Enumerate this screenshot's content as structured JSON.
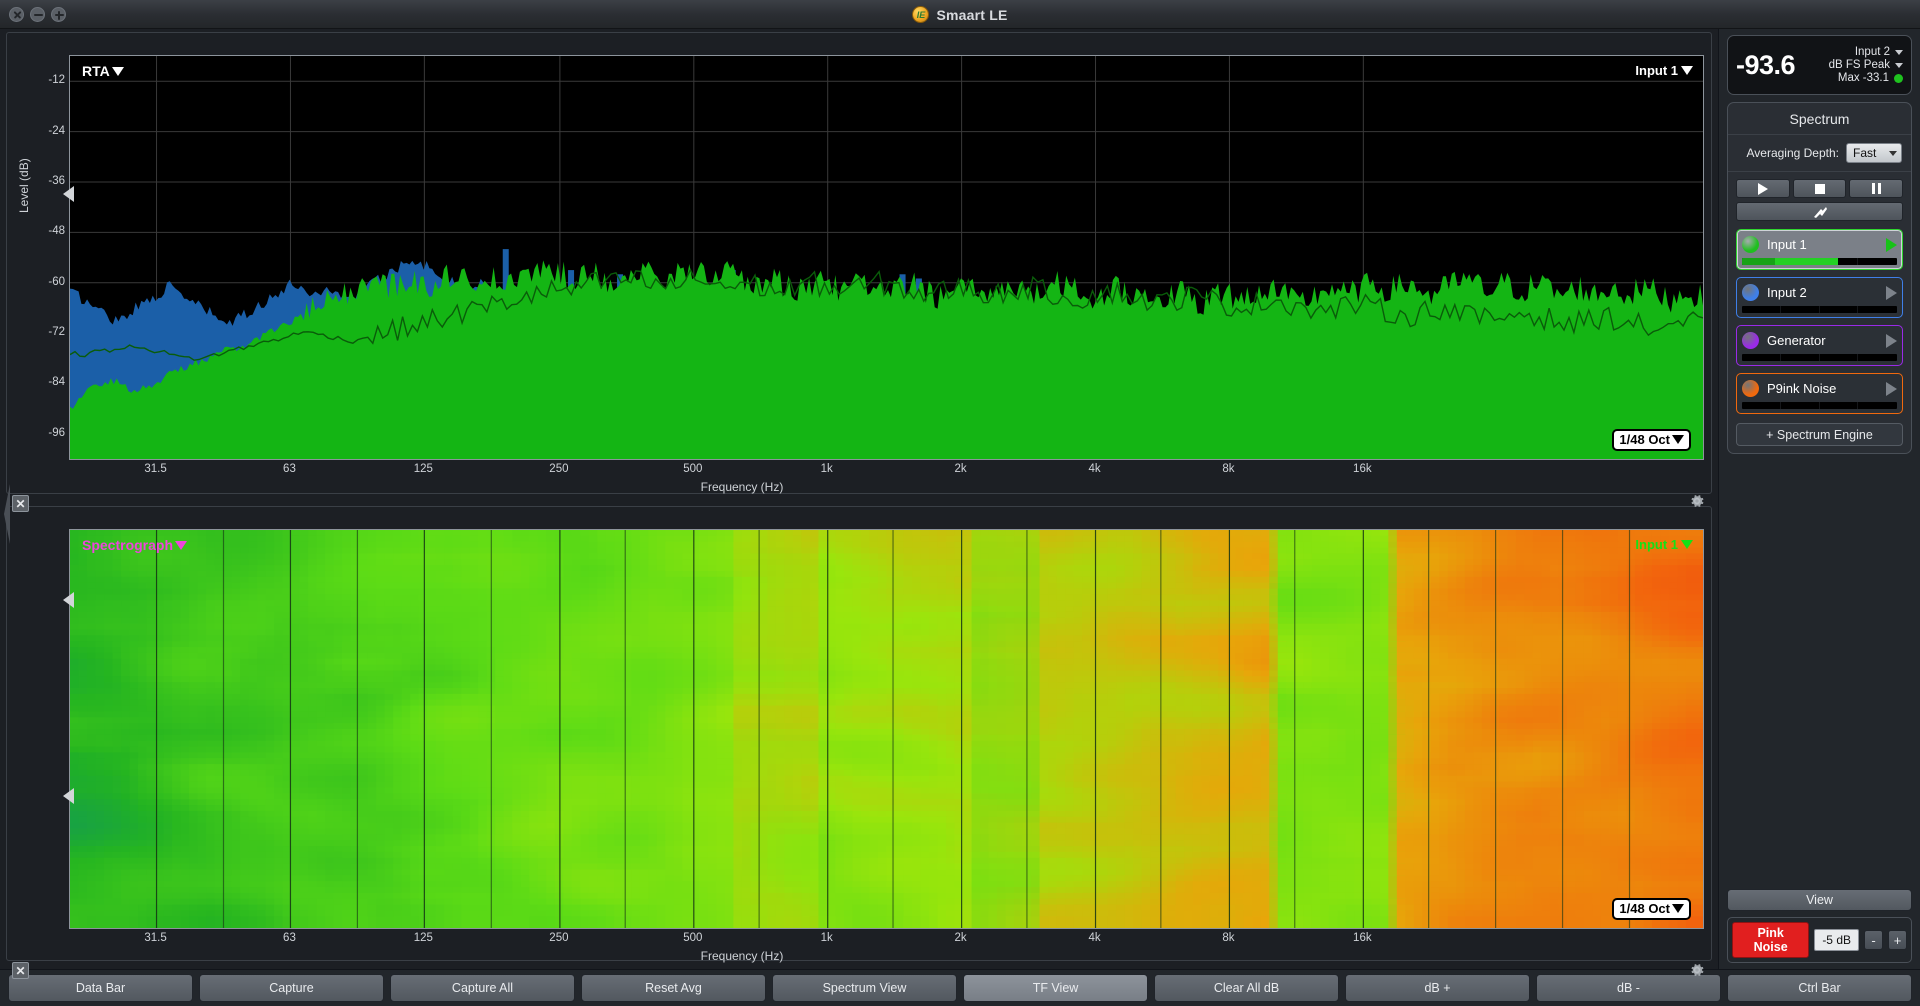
{
  "window": {
    "title": "Smaart LE",
    "logo_icon": "smaart-logo-icon",
    "buttons": {
      "close": "close-icon",
      "minimize": "minimize-icon",
      "maximize": "maximize-icon"
    }
  },
  "rta": {
    "title": "RTA",
    "corner_label": "Input 1",
    "octave_badge": "1/48 Oct",
    "ylabel": "Level (dB)",
    "xlabel": "Frequency (Hz)"
  },
  "spectrograph": {
    "title": "Spectrograph",
    "corner_label": "Input 1",
    "octave_badge": "1/48 Oct",
    "xlabel": "Frequency (Hz)",
    "title_color": "#ee44dd"
  },
  "data_bar": {
    "value": "-93.6",
    "source": "Input 2",
    "unit": "dB FS Peak",
    "max_label": "Max -33.1",
    "status_color": "#1fc21f"
  },
  "spectrum_panel": {
    "heading": "Spectrum",
    "averaging_label": "Averaging Depth:",
    "averaging_value": "Fast",
    "transport": [
      {
        "name": "play-button",
        "icon": "play-icon"
      },
      {
        "name": "stop-button",
        "icon": "stop-icon"
      },
      {
        "name": "pause-button",
        "icon": "pause-icon"
      }
    ],
    "tools_icon": "tools-hammer-wrench-icon",
    "engines": [
      {
        "label": "Input 1",
        "color": "#1fbf1f",
        "border": "#2fd62f",
        "active": true,
        "meter": 62
      },
      {
        "label": "Input 2",
        "color": "#3f7fe8",
        "border": "#3f7fe8",
        "active": false,
        "meter": 0
      },
      {
        "label": "Generator",
        "color": "#9a2ae8",
        "border": "#9a2ae8",
        "active": false,
        "meter": 0
      },
      {
        "label": "P9ink Noise",
        "color": "#f0690e",
        "border": "#f0690e",
        "active": false,
        "meter": 0
      }
    ],
    "add_engine": "+ Spectrum Engine"
  },
  "panel_bottom": {
    "view_label": "View",
    "generator_button": "Pink Noise",
    "generator_level": "-5 dB",
    "minus": "-",
    "plus": "+"
  },
  "ctrl_bar": [
    {
      "label": "Data Bar",
      "active": false
    },
    {
      "label": "Capture",
      "active": false
    },
    {
      "label": "Capture All",
      "active": false
    },
    {
      "label": "Reset Avg",
      "active": false
    },
    {
      "label": "Spectrum View",
      "active": false
    },
    {
      "label": "TF View",
      "active": true
    },
    {
      "label": "Clear All dB",
      "active": false
    },
    {
      "label": "dB +",
      "active": false
    },
    {
      "label": "dB -",
      "active": false
    },
    {
      "label": "Ctrl Bar",
      "active": false
    }
  ],
  "chart_data": {
    "type": "line",
    "title": "RTA",
    "xlabel": "Frequency (Hz)",
    "ylabel": "Level (dB)",
    "ylim": [
      -102,
      -6
    ],
    "yticks": [
      -12,
      -24,
      -36,
      -48,
      -60,
      -72,
      -84,
      -96
    ],
    "xticks": [
      "31.5",
      "63",
      "125",
      "250",
      "500",
      "1k",
      "2k",
      "4k",
      "8k",
      "16k"
    ],
    "xtick_positions_pct": [
      5.3,
      13.5,
      21.7,
      30.0,
      38.2,
      46.4,
      54.6,
      62.8,
      71.0,
      79.2
    ],
    "grid": true,
    "legend_position": "top-right",
    "series": [
      {
        "name": "Input 1",
        "color": "#14b514",
        "kind": "filled-bars",
        "values": [
          -90,
          -88,
          -86,
          -85,
          -84,
          -83,
          -84,
          -85,
          -86,
          -85,
          -84,
          -83,
          -82,
          -81,
          -80,
          -79,
          -79,
          -78,
          -77,
          -76,
          -76,
          -75,
          -74,
          -73,
          -72,
          -71,
          -70,
          -69,
          -68,
          -67,
          -66,
          -65,
          -64,
          -63,
          -62,
          -61,
          -61,
          -60,
          -60,
          -61,
          -60,
          -59,
          -60,
          -61,
          -60,
          -59,
          -58,
          -59,
          -60,
          -59,
          -58,
          -59,
          -60,
          -61,
          -60,
          -59,
          -58,
          -57,
          -56,
          -57,
          -58,
          -59,
          -58,
          -57,
          -58,
          -59,
          -60,
          -59,
          -58,
          -57,
          -58,
          -59,
          -60,
          -59,
          -58,
          -57,
          -56,
          -57,
          -58,
          -57,
          -58,
          -59,
          -60,
          -61,
          -60,
          -59,
          -60,
          -61,
          -62,
          -61,
          -60,
          -59,
          -60,
          -61,
          -62,
          -61,
          -60,
          -61,
          -62,
          -63,
          -62,
          -61,
          -60,
          -61,
          -62,
          -63,
          -64,
          -63,
          -62,
          -61,
          -62,
          -63,
          -62,
          -61,
          -60,
          -61,
          -62,
          -63,
          -62,
          -61,
          -60,
          -61,
          -62,
          -63,
          -64,
          -63,
          -62,
          -61,
          -62,
          -63,
          -62,
          -63,
          -64,
          -63,
          -62,
          -63,
          -64,
          -65,
          -64,
          -63,
          -62,
          -63,
          -64,
          -63,
          -62,
          -61,
          -62,
          -63,
          -64,
          -65,
          -64,
          -63,
          -62,
          -61,
          -62,
          -63,
          -62,
          -61,
          -60,
          -61,
          -62,
          -61,
          -60,
          -61,
          -62,
          -63,
          -62,
          -61,
          -60,
          -59,
          -60,
          -61,
          -62,
          -61,
          -60,
          -61,
          -62,
          -61,
          -60,
          -61,
          -62,
          -63,
          -62,
          -61,
          -62,
          -63,
          -62,
          -61,
          -62,
          -63,
          -62,
          -61,
          -62,
          -63,
          -64,
          -63,
          -62,
          -63,
          -64
        ]
      },
      {
        "name": "Input 2",
        "color": "#1b5fa8",
        "kind": "filled-bars",
        "values": [
          -62,
          -63,
          -64,
          -65,
          -66,
          -67,
          -68,
          -69,
          -68,
          -67,
          -66,
          -65,
          -64,
          -63,
          -62,
          -61,
          -62,
          -63,
          -64,
          -65,
          -66,
          -67,
          -68,
          -69,
          -70,
          -69,
          -68,
          -67,
          -66,
          -65,
          -64,
          -63,
          -62,
          -61,
          -60,
          -61,
          -62,
          -63,
          -62,
          -61,
          -62,
          -63,
          -64,
          -63,
          -62,
          -61,
          -60,
          -59,
          -58,
          -57,
          -56,
          -55,
          -54,
          -55,
          -56,
          -57,
          -58,
          -59,
          -60,
          -61,
          -62,
          -61,
          -60,
          -61,
          -62,
          -63,
          -64,
          -63,
          -62,
          -61,
          -62,
          -63,
          -64,
          -63,
          -62,
          -63,
          -64,
          -63,
          -62,
          -63,
          -64,
          -63,
          -62,
          -63,
          -64,
          -63,
          -62,
          -63,
          -64,
          -63,
          -62,
          -63,
          -64,
          -63,
          -62,
          -63,
          -64,
          -63,
          -62,
          -63
        ]
      },
      {
        "name": "Input 1 trace",
        "color": "#0a5c0a",
        "kind": "line",
        "values": [
          -77,
          -77,
          -76,
          -76,
          -75,
          -76,
          -77,
          -78,
          -78,
          -77,
          -76,
          -75,
          -74,
          -73,
          -72,
          -72,
          -73,
          -74,
          -73,
          -72,
          -71,
          -70,
          -69,
          -68,
          -67,
          -66,
          -65,
          -64,
          -63,
          -62,
          -62,
          -61,
          -60,
          -60,
          -59,
          -60,
          -61,
          -60,
          -59,
          -60,
          -61,
          -60,
          -61,
          -62,
          -61,
          -60,
          -61,
          -62,
          -61,
          -60,
          -61,
          -62,
          -63,
          -62,
          -61,
          -62,
          -63,
          -62,
          -61,
          -62,
          -63,
          -64,
          -63,
          -62,
          -63,
          -64,
          -65,
          -64,
          -63,
          -64,
          -65,
          -66,
          -65,
          -64,
          -65,
          -66,
          -67,
          -66,
          -65,
          -66,
          -67,
          -68,
          -67,
          -66,
          -67,
          -68,
          -69,
          -68,
          -67,
          -68,
          -69,
          -70,
          -69,
          -68,
          -69,
          -70,
          -71,
          -70,
          -69,
          -70
        ]
      }
    ]
  },
  "spectrograph_data": {
    "type": "heatmap",
    "colormap": [
      "#0d8f6e",
      "#22b321",
      "#5ddc16",
      "#9be60c",
      "#e8a60a",
      "#f2670d",
      "#ee3a0b"
    ],
    "xticks": [
      "31.5",
      "63",
      "125",
      "250",
      "500",
      "1k",
      "2k",
      "4k",
      "8k",
      "16k"
    ]
  }
}
